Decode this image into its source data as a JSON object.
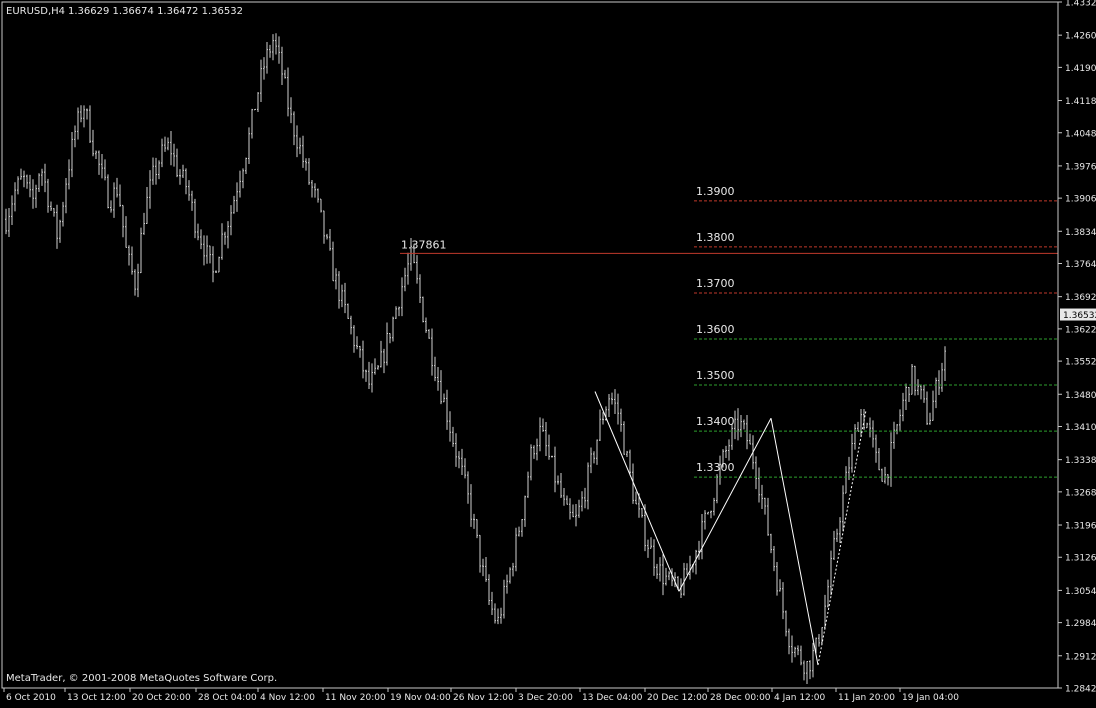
{
  "header": {
    "symbol": "EURUSD,H4",
    "ohlc": "1.36629 1.36674 1.36472 1.36532"
  },
  "footer": {
    "copyright": "MetaTrader, © 2001-2008 MetaQuotes Software Corp."
  },
  "colors": {
    "background": "#000000",
    "bars": "#cfcfcf",
    "frame": "#c8c8c8",
    "zigzag": "#ffffff",
    "resistance_line": "#c0392b",
    "red_levels": "#c0392b",
    "green_levels": "#2e9e2e",
    "price_tag_bg": "#e8e8e8",
    "price_tag_text": "#000000"
  },
  "chart_data": {
    "type": "ohlc",
    "timeframe": "H4",
    "y_ticks": [
      "1.43320",
      "1.42600",
      "1.41900",
      "1.41180",
      "1.40480",
      "1.39760",
      "1.39060",
      "1.38340",
      "1.37640",
      "1.36920",
      "1.36220",
      "1.35520",
      "1.34800",
      "1.34100",
      "1.33380",
      "1.32680",
      "1.31960",
      "1.31260",
      "1.30540",
      "1.29840",
      "1.29120",
      "1.28420"
    ],
    "ylim": [
      1.2842,
      1.4332
    ],
    "current_price": "1.36532",
    "x_ticks": [
      "6 Oct 2010",
      "13 Oct 12:00",
      "20 Oct 20:00",
      "28 Oct 04:00",
      "4 Nov 12:00",
      "11 Nov 20:00",
      "19 Nov 04:00",
      "26 Nov 12:00",
      "3 Dec 20:00",
      "13 Dec 04:00",
      "20 Dec 12:00",
      "28 Dec 00:00",
      "4 Jan 12:00",
      "11 Jan 20:00",
      "19 Jan 04:00"
    ],
    "price_path": [
      1.386,
      1.392,
      1.395,
      1.389,
      1.398,
      1.39,
      1.382,
      1.395,
      1.405,
      1.411,
      1.403,
      1.396,
      1.39,
      1.393,
      1.378,
      1.372,
      1.387,
      1.395,
      1.4,
      1.402,
      1.396,
      1.393,
      1.385,
      1.38,
      1.374,
      1.382,
      1.387,
      1.395,
      1.402,
      1.412,
      1.42,
      1.425,
      1.418,
      1.408,
      1.402,
      1.395,
      1.39,
      1.382,
      1.374,
      1.368,
      1.362,
      1.356,
      1.35,
      1.352,
      1.358,
      1.365,
      1.372,
      1.378,
      1.369,
      1.36,
      1.352,
      1.345,
      1.337,
      1.33,
      1.322,
      1.312,
      1.303,
      1.298,
      1.306,
      1.314,
      1.324,
      1.336,
      1.34,
      1.334,
      1.328,
      1.322,
      1.32,
      1.326,
      1.334,
      1.342,
      1.348,
      1.344,
      1.334,
      1.324,
      1.318,
      1.313,
      1.309,
      1.307,
      1.305,
      1.309,
      1.314,
      1.32,
      1.326,
      1.333,
      1.338,
      1.342,
      1.338,
      1.332,
      1.322,
      1.312,
      1.302,
      1.294,
      1.291,
      1.289,
      1.293,
      1.302,
      1.314,
      1.325,
      1.335,
      1.344,
      1.341,
      1.333,
      1.33,
      1.338,
      1.346,
      1.352,
      1.348,
      1.342,
      1.35,
      1.358,
      1.364,
      1.367
    ],
    "high_label": "1.37861",
    "high_level": 1.37861,
    "levels": [
      {
        "label": "1.3900",
        "value": 1.39,
        "color": "red"
      },
      {
        "label": "1.3800",
        "value": 1.38,
        "color": "red"
      },
      {
        "label": "1.3700",
        "value": 1.37,
        "color": "red"
      },
      {
        "label": "1.3600",
        "value": 1.36,
        "color": "green"
      },
      {
        "label": "1.3500",
        "value": 1.35,
        "color": "green"
      },
      {
        "label": "1.3400",
        "value": 1.34,
        "color": "green"
      },
      {
        "label": "1.3300",
        "value": 1.33,
        "color": "green"
      }
    ],
    "zigzag": [
      {
        "t": "13 Dec 04:00",
        "price": 1.3486
      },
      {
        "t": "20 Dec 12:00",
        "price": 1.3052
      },
      {
        "t": "4 Jan 12:00",
        "price": 1.3428
      },
      {
        "t": "11 Jan 20:00",
        "price": 1.2892
      },
      {
        "t": "19 Jan 04:00",
        "price": 1.3445
      }
    ]
  }
}
